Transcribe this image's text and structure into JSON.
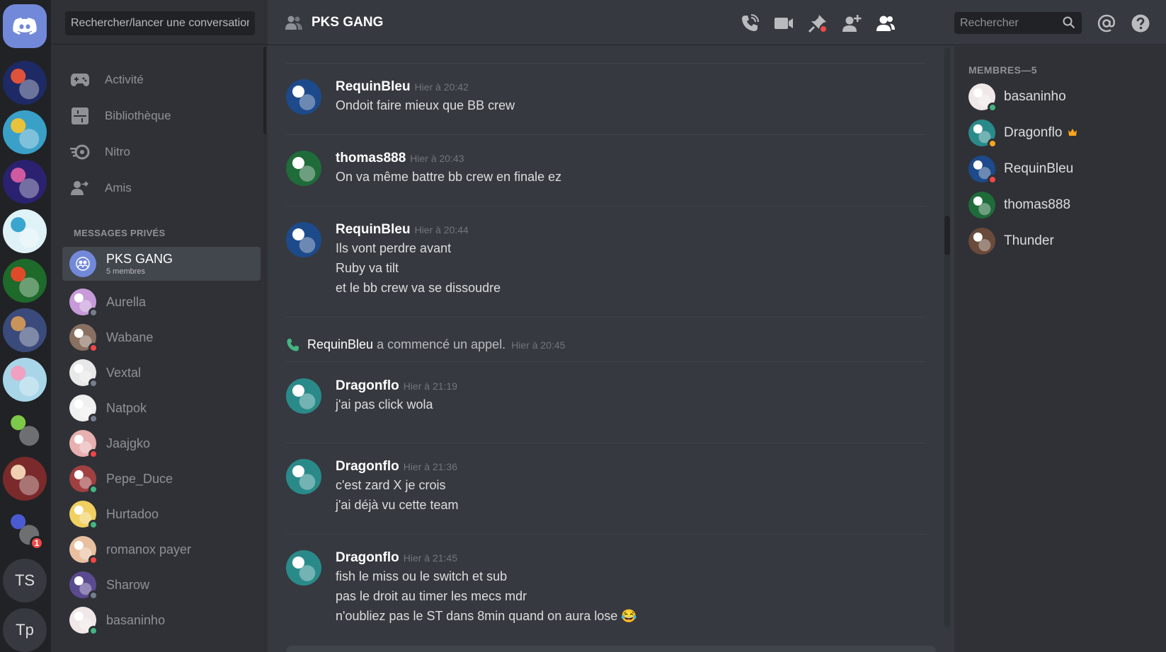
{
  "servers": [
    {
      "name": "home",
      "icon": "discord-logo-icon"
    },
    {
      "name": "server-1",
      "color": "#1e2a66",
      "accent": "#e0533a"
    },
    {
      "name": "server-2",
      "color": "#3aa0c8",
      "accent": "#e8c23a"
    },
    {
      "name": "server-3",
      "color": "#2a2270",
      "accent": "#d05aa0"
    },
    {
      "name": "server-4",
      "color": "#dff2f8",
      "accent": "#3aa6d0"
    },
    {
      "name": "server-5",
      "color": "#1d6a2a",
      "accent": "#e04a2a"
    },
    {
      "name": "server-6",
      "color": "#3a4a7a",
      "accent": "#c9945a"
    },
    {
      "name": "server-7",
      "color": "#a8d6e8",
      "accent": "#f0a0c0"
    },
    {
      "name": "server-8",
      "color": "#202225",
      "accent": "#7ec84a"
    },
    {
      "name": "server-9",
      "color": "#7a2a2a",
      "accent": "#f0d0b0"
    },
    {
      "name": "server-10",
      "color": "#202225",
      "accent": "#4a5ad0",
      "badge": "1"
    },
    {
      "name": "server-ts",
      "label": "TS"
    },
    {
      "name": "server-tp",
      "label": "Tp"
    }
  ],
  "sidebar": {
    "search_placeholder": "Rechercher/lancer une conversation",
    "nav": [
      {
        "label": "Activité",
        "icon": "gamepad-icon"
      },
      {
        "label": "Bibliothèque",
        "icon": "library-icon"
      },
      {
        "label": "Nitro",
        "icon": "nitro-icon"
      },
      {
        "label": "Amis",
        "icon": "friends-icon"
      }
    ],
    "dm_heading": "MESSAGES PRIVÉS",
    "dms": [
      {
        "name": "PKS GANG",
        "sub": "5 membres",
        "color": "#7289da",
        "status": "none"
      },
      {
        "name": "Aurella",
        "color": "#c79ad8",
        "status": "offline"
      },
      {
        "name": "Wabane",
        "color": "#8a7060",
        "status": "dnd"
      },
      {
        "name": "Vextal",
        "color": "#e8e8e8",
        "status": "offline"
      },
      {
        "name": "Natpok",
        "color": "#f0f0f0",
        "status": "offline"
      },
      {
        "name": "Jaajgko",
        "color": "#e8b0b0",
        "status": "dnd"
      },
      {
        "name": "Pepe_Duce",
        "color": "#a04040",
        "status": "online"
      },
      {
        "name": "Hurtadoo",
        "color": "#f0d060",
        "status": "online"
      },
      {
        "name": "romanox payer",
        "color": "#e8c0a0",
        "status": "dnd"
      },
      {
        "name": "Sharow",
        "color": "#5a4a90",
        "status": "offline"
      },
      {
        "name": "basaninho",
        "color": "#f0e8e8",
        "status": "online"
      }
    ]
  },
  "header": {
    "title": "PKS GANG",
    "search_placeholder": "Rechercher"
  },
  "messages": [
    {
      "author": "RequinBleu",
      "time": "Hier à 20:42",
      "avatar": "#1d4a8a",
      "lines": [
        "Ondoit faire mieux que BB crew"
      ]
    },
    {
      "author": "thomas888",
      "time": "Hier à 20:43",
      "avatar": "#1f6b3a",
      "lines": [
        "On va même battre bb crew en finale ez"
      ]
    },
    {
      "author": "RequinBleu",
      "time": "Hier à 20:44",
      "avatar": "#1d4a8a",
      "lines": [
        "Ils vont perdre avant",
        "Ruby va tilt",
        "et le bb crew va se dissoudre"
      ]
    },
    {
      "author": "Dragonflo",
      "time": "Hier à 21:19",
      "avatar": "#2a8a8a",
      "lines": [
        "j'ai pas click wola"
      ]
    },
    {
      "author": "Dragonflo",
      "time": "Hier à 21:36",
      "avatar": "#2a8a8a",
      "lines": [
        "c'est zard X je crois",
        "j'ai déjà vu cette team"
      ]
    },
    {
      "author": "Dragonflo",
      "time": "Hier à 21:45",
      "avatar": "#2a8a8a",
      "lines": [
        "fish le miss ou le switch et sub",
        "pas le droit au timer les mecs mdr",
        "n'oubliez pas le ST dans 8min quand on aura lose 😂"
      ]
    }
  ],
  "call_event": {
    "author": "RequinBleu",
    "text": "a commencé un appel.",
    "time": "Hier à 20:45"
  },
  "members": {
    "heading": "MEMBRES—5",
    "list": [
      {
        "name": "basaninho",
        "color": "#f0e8e8",
        "status": "online"
      },
      {
        "name": "Dragonflo",
        "color": "#2a8a8a",
        "status": "idle",
        "owner": true
      },
      {
        "name": "RequinBleu",
        "color": "#1d4a8a",
        "status": "dnd"
      },
      {
        "name": "thomas888",
        "color": "#1f6b3a",
        "status": "none"
      },
      {
        "name": "Thunder",
        "color": "#6a4a3a",
        "status": "none"
      }
    ]
  }
}
